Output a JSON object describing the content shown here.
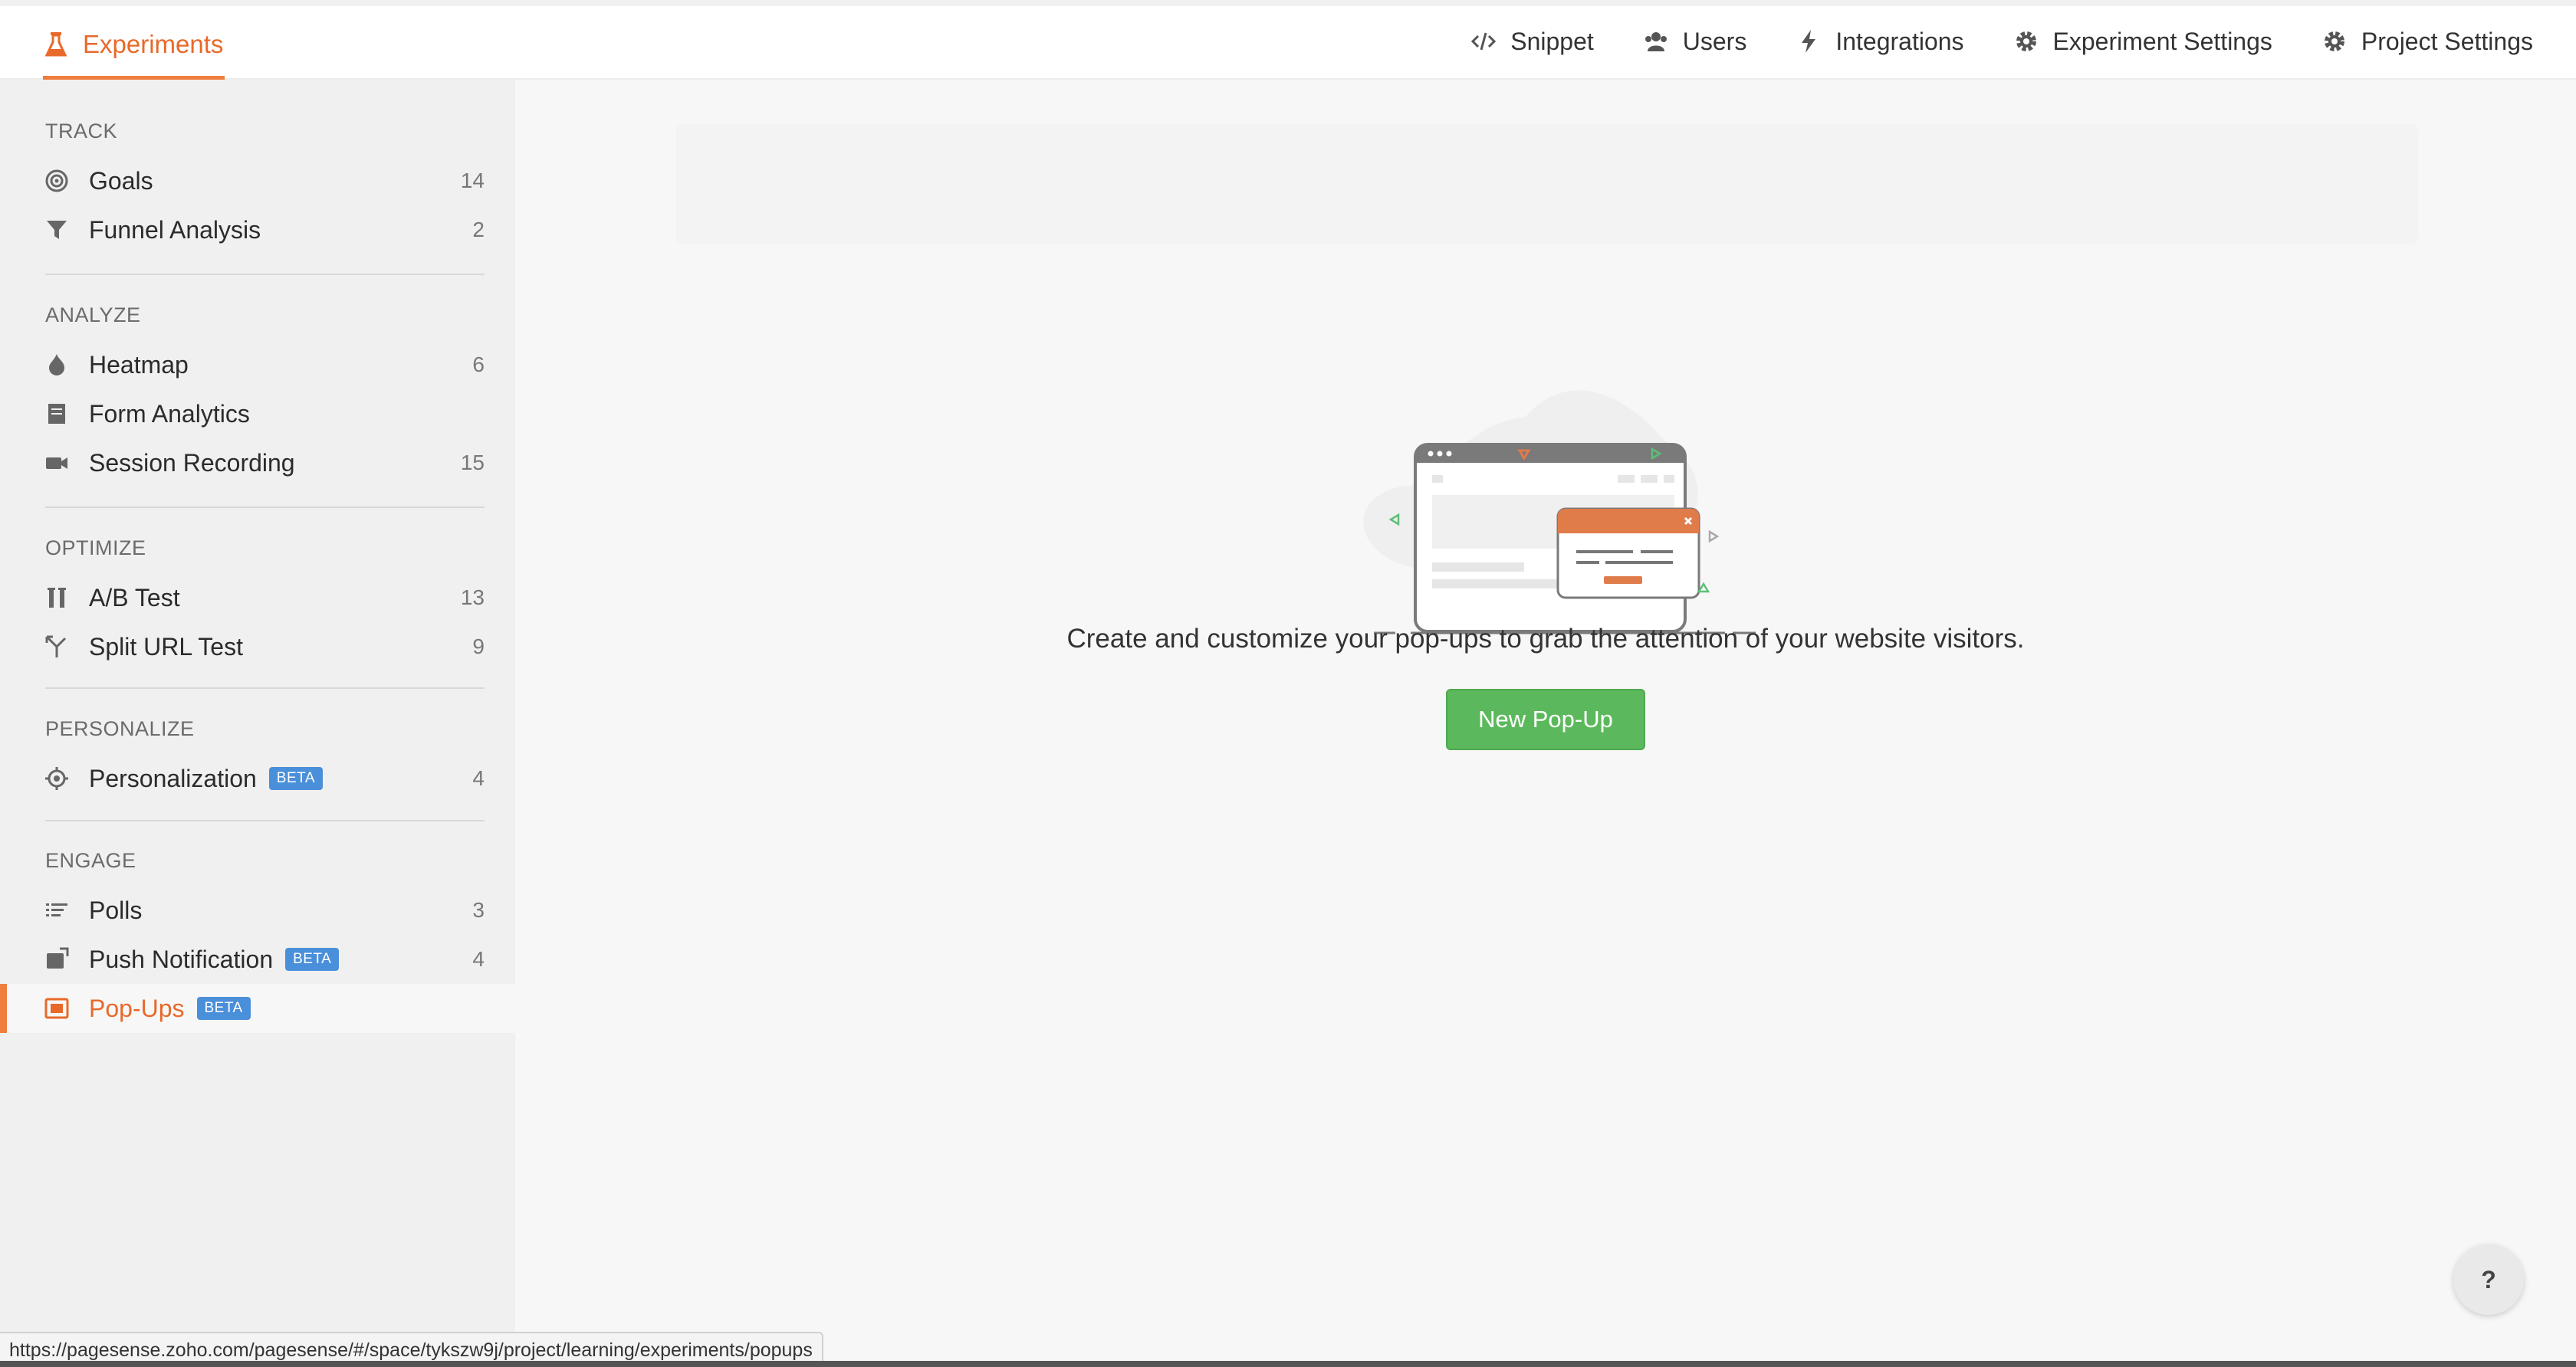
{
  "colors": {
    "accent": "#e8692a",
    "primary_button": "#5cb85c",
    "beta_badge": "#4a8fd9"
  },
  "header": {
    "active_tab": {
      "label": "Experiments",
      "icon": "flask-icon"
    },
    "nav": [
      {
        "label": "Snippet",
        "icon": "code-icon"
      },
      {
        "label": "Users",
        "icon": "users-icon"
      },
      {
        "label": "Integrations",
        "icon": "bolt-icon"
      },
      {
        "label": "Experiment Settings",
        "icon": "gear-icon"
      },
      {
        "label": "Project Settings",
        "icon": "gear-icon"
      }
    ]
  },
  "sidebar": {
    "sections": [
      {
        "title": "TRACK",
        "items": [
          {
            "label": "Goals",
            "count": "14",
            "icon": "target-icon"
          },
          {
            "label": "Funnel Analysis",
            "count": "2",
            "icon": "funnel-icon"
          }
        ]
      },
      {
        "title": "ANALYZE",
        "items": [
          {
            "label": "Heatmap",
            "count": "6",
            "icon": "flame-icon"
          },
          {
            "label": "Form Analytics",
            "count": "",
            "icon": "form-icon"
          },
          {
            "label": "Session Recording",
            "count": "15",
            "icon": "video-icon"
          }
        ]
      },
      {
        "title": "OPTIMIZE",
        "items": [
          {
            "label": "A/B Test",
            "count": "13",
            "icon": "ab-test-icon"
          },
          {
            "label": "Split URL Test",
            "count": "9",
            "icon": "split-icon"
          }
        ]
      },
      {
        "title": "PERSONALIZE",
        "items": [
          {
            "label": "Personalization",
            "badge": "BETA",
            "count": "4",
            "icon": "crosshair-icon"
          }
        ]
      },
      {
        "title": "ENGAGE",
        "items": [
          {
            "label": "Polls",
            "count": "3",
            "icon": "list-icon"
          },
          {
            "label": "Push Notification",
            "badge": "BETA",
            "count": "4",
            "icon": "notification-icon"
          },
          {
            "label": "Pop-Ups",
            "badge": "BETA",
            "count": "",
            "icon": "popup-icon",
            "active": true
          }
        ]
      }
    ]
  },
  "main": {
    "empty_state_text": "Create and customize your pop-ups to grab the attention of your website visitors.",
    "new_button_label": "New Pop-Up"
  },
  "help_label": "?",
  "status_url": "https://pagesense.zoho.com/pagesense/#/space/tykszw9j/project/learning/experiments/popups"
}
